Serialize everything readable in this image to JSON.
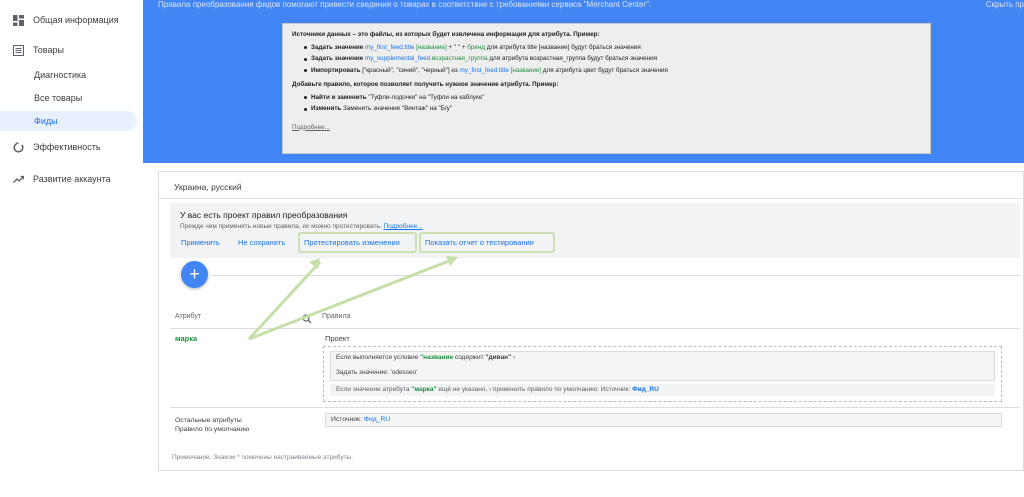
{
  "sidebar": {
    "items": [
      {
        "label": "Общая информация",
        "icon": "dashboard-icon"
      },
      {
        "label": "Товары",
        "icon": "list-icon"
      },
      {
        "label": "Эффективность",
        "icon": "performance-icon"
      },
      {
        "label": "Развитие аккаунта",
        "icon": "trending-up-icon"
      }
    ],
    "subitems": [
      {
        "label": "Диагностика"
      },
      {
        "label": "Все товары"
      },
      {
        "label": "Фиды",
        "active": true
      }
    ]
  },
  "banner": {
    "top_text": "Правила преобразования фидов помогают привести сведения о товарах в соответствие с требованиями сервиса \"Merchant Center\".",
    "top_right": "Скрыть пр",
    "help": {
      "heading1": "Источники данных – это файлы, из которых будет извлечена информация для атрибута. Пример:",
      "ex1_a": "Задать значение",
      "ex1_b": "my_first_feed",
      "ex1_c": ".title",
      "ex1_d": "[название]",
      "ex1_e": " + \" \" + ",
      "ex1_f": "бренд",
      "ex1_g": " для атрибута title [название] будут браться значения",
      "ex2_a": "Задать значение",
      "ex2_b": "my_supplemental_feed",
      "ex2_c": ".возрастная_группа",
      "ex2_d": " для атрибута возрастная_группа будут браться значения",
      "ex3_a": "Импортировать",
      "ex3_b": " [\"красный\", \"синий\", \"черный\"] из ",
      "ex3_c": "my_first_feed",
      "ex3_d": ".title",
      "ex3_e": " [название]",
      "ex3_f": " для атрибута цвет будут браться значения",
      "heading2": "Добавьте правило, которое позволяет получить нужное значение атрибута. Пример:",
      "ex4_a": "Найти и заменить",
      "ex4_b": " \"Туфли-лодочки\" на \"Туфли на каблуке\"",
      "ex5_a": "Изменить",
      "ex5_b": " Заменить значение \"Винтаж\" на \"Б/у\"",
      "more": "Подробнее..."
    }
  },
  "main": {
    "language": "Украина, русский",
    "draft": {
      "title": "У вас есть проект правил преобразования",
      "subtitle": "Прежде чем применять новые правила, их можно протестировать. ",
      "more_link": "Подробнее..."
    },
    "actions": {
      "apply": "Применить",
      "discard": "Не сохранять",
      "test": "Протестировать изменения",
      "report": "Показать отчет о тестировании"
    },
    "fab_symbol": "+",
    "table": {
      "col_attribute": "Атрибут",
      "col_rules": "Правила"
    },
    "row": {
      "attribute": "марка",
      "project_label": "Проект",
      "cond_a": "Если выполняется условие ",
      "cond_b": "\"название",
      "cond_c": " содержит ",
      "cond_d": "\"диван\"",
      "cond_e": " ›",
      "set_a": "Задать значение: ",
      "set_b": "'odesseo'",
      "def_a": "Если значение атрибута ",
      "def_b": "\"марка\"",
      "def_c": " ещё не указано, › применить правило по умолчанию: Источник: ",
      "def_d": "Фид_RU"
    },
    "other": {
      "line1": "Остальные атрибуты",
      "line2": "Правило по умолчанию",
      "source_label": "Источник: ",
      "source_value": "Фид_RU"
    },
    "note": "Примечание. Знаком * помечены настраиваемые атрибуты."
  },
  "colors": {
    "banner": "#4285f4",
    "link": "#1a73e8",
    "attr_green": "#1e8e3e",
    "highlight": "#cde0b3",
    "annotation_arrow": "#c5dfa8"
  }
}
